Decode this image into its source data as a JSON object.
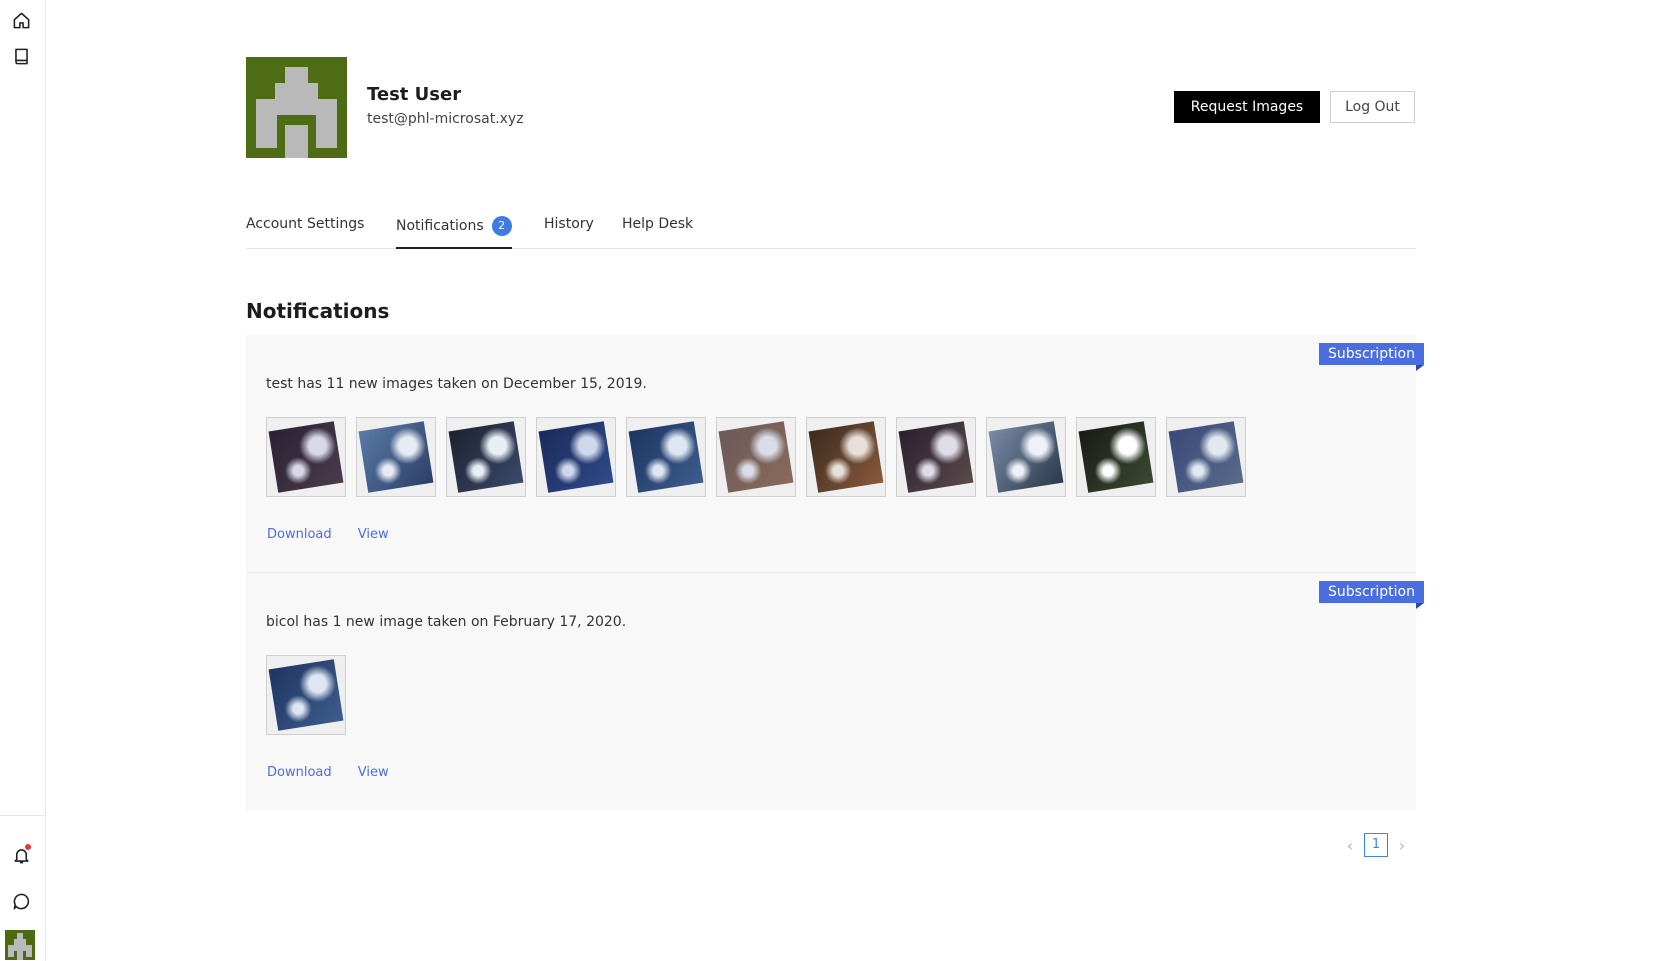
{
  "sidebar": {
    "icons": [
      "home-icon",
      "book-icon",
      "bell-icon",
      "chat-icon"
    ],
    "has_unread": true
  },
  "profile": {
    "name": "Test User",
    "email": "test@phl-microsat.xyz"
  },
  "actions": {
    "request_label": "Request Images",
    "logout_label": "Log Out"
  },
  "tabs": [
    {
      "label": "Account Settings",
      "active": false
    },
    {
      "label": "Notifications",
      "active": true,
      "badge": "2"
    },
    {
      "label": "History",
      "active": false
    },
    {
      "label": "Help Desk",
      "active": false
    }
  ],
  "section_title": "Notifications",
  "notifications": [
    {
      "tag": "Subscription",
      "message": "test has 11 new images taken on December 15, 2019.",
      "image_count": 11,
      "download_label": "Download",
      "view_label": "View"
    },
    {
      "tag": "Subscription",
      "message": "bicol has 1 new image taken on February 17, 2020.",
      "image_count": 1,
      "download_label": "Download",
      "view_label": "View"
    }
  ],
  "pagination": {
    "current": "1",
    "prev_icon": "chevron-left-icon",
    "next_icon": "chevron-right-icon"
  },
  "colors": {
    "accent": "#4a6ee0",
    "badge": "#3e7be4",
    "avatar_bg": "#4d6c14"
  }
}
